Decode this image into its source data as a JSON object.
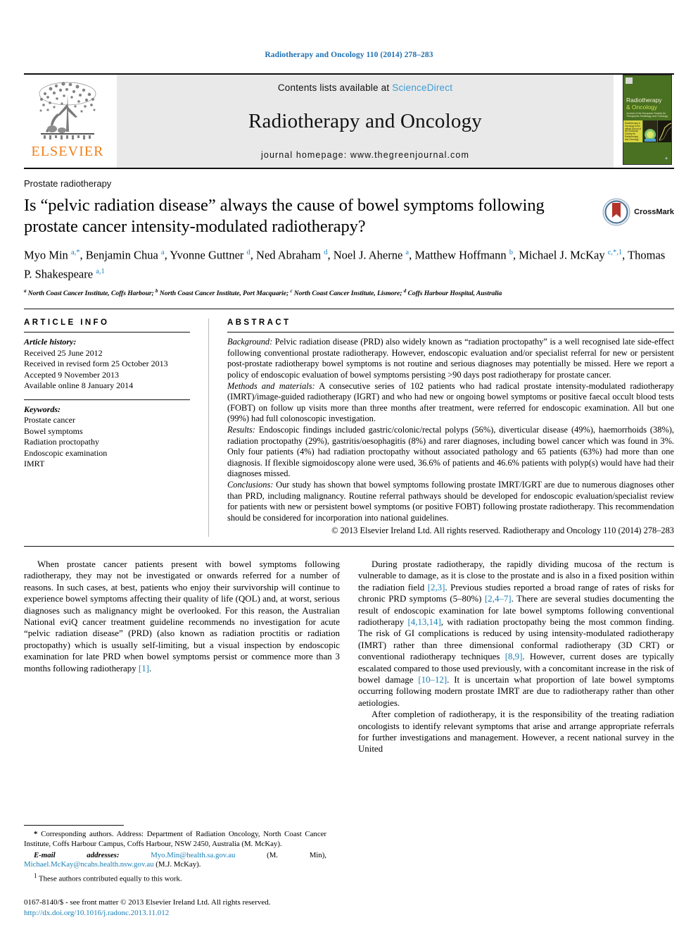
{
  "running_head": "Radiotherapy and Oncology 110 (2014) 278–283",
  "masthead": {
    "publisher_name": "ELSEVIER",
    "contents_prefix": "Contents lists available at ",
    "contents_link": "ScienceDirect",
    "journal_name": "Radiotherapy and Oncology",
    "homepage": "journal homepage: www.thegreenjournal.com",
    "cover": {
      "title_line1": "Radiotherapy",
      "title_line2": "& Oncology",
      "subtitle": "Journal of the European Society for Therapeutic Radiology and Oncology",
      "blurb": "Radiotherapy & Oncology is the official journal of the European Society for Radiotherapy and Oncology"
    }
  },
  "article": {
    "section_label": "Prostate radiotherapy",
    "title": "Is “pelvic radiation disease” always the cause of bowel symptoms following prostate cancer intensity-modulated radiotherapy?",
    "crossmark_label": "CrossMark",
    "authors_html": "Myo Min <sup>a,*</sup>, Benjamin Chua <sup>a</sup>, Yvonne Guttner <sup>d</sup>, Ned Abraham <sup>d</sup>, Noel J. Aherne <sup>a</sup>, Matthew Hoffmann <sup>b</sup>, Michael J. McKay <sup>c,*,1</sup>, Thomas P. Shakespeare <sup>a,1</sup>",
    "affiliations_html": "<sup>a</sup> North Coast Cancer Institute, Coffs Harbour; <sup>b</sup> North Coast Cancer Institute, Port Macquarie; <sup>c</sup> North Coast Cancer Institute, Lismore; <sup>d</sup> Coffs Harbour Hospital, Australia"
  },
  "info": {
    "heading": "ARTICLE INFO",
    "history_label": "Article history:",
    "history": [
      "Received 25 June 2012",
      "Received in revised form 25 October 2013",
      "Accepted 9 November 2013",
      "Available online 8 January 2014"
    ],
    "keywords_label": "Keywords:",
    "keywords": [
      "Prostate cancer",
      "Bowel symptoms",
      "Radiation proctopathy",
      "Endoscopic examination",
      "IMRT"
    ]
  },
  "abstract": {
    "heading": "ABSTRACT",
    "background_label": "Background:",
    "background": " Pelvic radiation disease (PRD) also widely known as “radiation proctopathy” is a well recognised late side-effect following conventional prostate radiotherapy. However, endoscopic evaluation and/or specialist referral for new or persistent post-prostate radiotherapy bowel symptoms is not routine and serious diagnoses may potentially be missed. Here we report a policy of endoscopic evaluation of bowel symptoms persisting >90 days post radiotherapy for prostate cancer.",
    "methods_label": "Methods and materials:",
    "methods": " A consecutive series of 102 patients who had radical prostate intensity-modulated radiotherapy (IMRT)/image-guided radiotherapy (IGRT) and who had new or ongoing bowel symptoms or positive faecal occult blood tests (FOBT) on follow up visits more than three months after treatment, were referred for endoscopic examination. All but one (99%) had full colonoscopic investigation.",
    "results_label": "Results:",
    "results": " Endoscopic findings included gastric/colonic/rectal polyps (56%), diverticular disease (49%), haemorrhoids (38%), radiation proctopathy (29%), gastritis/oesophagitis (8%) and rarer diagnoses, including bowel cancer which was found in 3%. Only four patients (4%) had radiation proctopathy without associated pathology and 65 patients (63%) had more than one diagnosis. If flexible sigmoidoscopy alone were used, 36.6% of patients and 46.6% patients with polyp(s) would have had their diagnoses missed.",
    "conclusions_label": "Conclusions:",
    "conclusions": " Our study has shown that bowel symptoms following prostate IMRT/IGRT are due to numerous diagnoses other than PRD, including malignancy. Routine referral pathways should be developed for endoscopic evaluation/specialist review for patients with new or persistent bowel symptoms (or positive FOBT) following prostate radiotherapy. This recommendation should be considered for incorporation into national guidelines.",
    "copyright": "© 2013 Elsevier Ireland Ltd. All rights reserved. Radiotherapy and Oncology 110 (2014) 278–283"
  },
  "body": {
    "left_para_html": "When prostate cancer patients present with bowel symptoms following radiotherapy, they may not be investigated or onwards referred for a number of reasons. In such cases, at best, patients who enjoy their survivorship will continue to experience bowel symptoms affecting their quality of life (QOL) and, at worst, serious diagnoses such as malignancy might be overlooked. For this reason, the Australian National eviQ cancer treatment guideline recommends no investigation for acute “pelvic radiation disease” (PRD) (also known as radiation proctitis or radiation proctopathy) which is usually self-limiting, but a visual inspection by endoscopic examination for late PRD when bowel symptoms persist or commence more than 3 months following radiotherapy <span class=\"ref\">[1]</span>.",
    "right_para1_html": "During prostate radiotherapy, the rapidly dividing mucosa of the rectum is vulnerable to damage, as it is close to the prostate and is also in a fixed position within the radiation field <span class=\"ref\">[2,3]</span>. Previous studies reported a broad range of rates of risks for chronic PRD symptoms (5–80%) <span class=\"ref\">[2,4–7]</span>. There are several studies documenting the result of endoscopic examination for late bowel symptoms following conventional radiotherapy <span class=\"ref\">[4,13,14]</span>, with radiation proctopathy being the most common finding. The risk of GI complications is reduced by using intensity-modulated radiotherapy (IMRT) rather than three dimensional conformal radiotherapy (3D CRT) or conventional radiotherapy techniques <span class=\"ref\">[8,9]</span>. However, current doses are typically escalated compared to those used previously, with a concomitant increase in the risk of bowel damage <span class=\"ref\">[10–12]</span>. It is uncertain what proportion of late bowel symptoms occurring following modern prostate IMRT are due to radiotherapy rather than other aetiologies.",
    "right_para2_html": "After completion of radiotherapy, it is the responsibility of the treating radiation oncologists to identify relevant symptoms that arise and arrange appropriate referrals for further investigations and management. However, a recent national survey in the United"
  },
  "footnotes": {
    "corresponding_html": "<span style=\"font-weight:bold\">*</span> Corresponding authors. Address: Department of Radiation Oncology, North Coast Cancer Institute, Coffs Harbour Campus, Coffs Harbour, NSW 2450, Australia (M. McKay).",
    "emails_html": "<span class=\"lbl\">E-mail addresses:</span> <span class=\"lnk\">Myo.Min@health.sa.gov.au</span> (M. Min), <span class=\"lnk\">Michael.McKay@ncahs.health.nsw.gov.au</span> (M.J. McKay).",
    "equal_contrib_html": "<sup>1</sup> These authors contributed equally to this work."
  },
  "imprint": {
    "line1": "0167-8140/$ - see front matter © 2013 Elsevier Ireland Ltd. All rights reserved.",
    "doi": "http://dx.doi.org/10.1016/j.radonc.2013.11.012"
  }
}
